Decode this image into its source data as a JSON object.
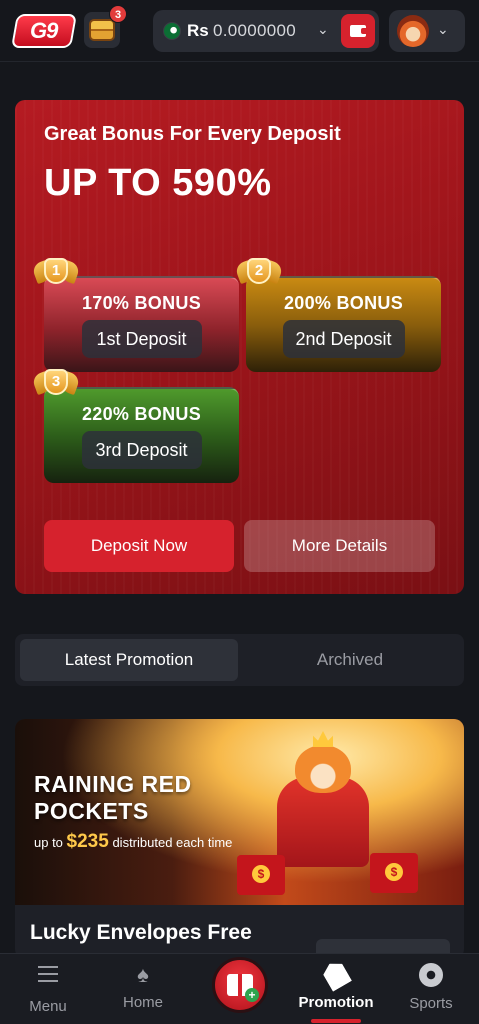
{
  "header": {
    "logo_text": "G9",
    "chest_badge": "3",
    "currency": "Rs",
    "balance": "0.0000000",
    "caret": "⌄"
  },
  "bonus": {
    "title": "Great Bonus For Every Deposit",
    "headline": "UP TO 590%",
    "tiers": [
      {
        "rank": "1",
        "label": "170% BONUS",
        "deposit": "1st Deposit"
      },
      {
        "rank": "2",
        "label": "200% BONUS",
        "deposit": "2nd Deposit"
      },
      {
        "rank": "3",
        "label": "220% BONUS",
        "deposit": "3rd Deposit"
      }
    ],
    "deposit_now": "Deposit Now",
    "more_details": "More Details"
  },
  "tabs": {
    "latest": "Latest Promotion",
    "archived": "Archived"
  },
  "promo": {
    "banner_title": "RAINING RED POCKETS",
    "sub_prefix": "up to",
    "sub_amount": "$235",
    "sub_suffix": "distributed each time",
    "name": "Lucky Envelopes Free"
  },
  "nav": {
    "menu": "Menu",
    "home": "Home",
    "promotion": "Promotion",
    "sports": "Sports",
    "gift_plus": "+"
  },
  "colors": {
    "accent": "#d6222d",
    "background": "#15171c",
    "panel": "#1e2027",
    "gold": "#ffc94a"
  },
  "icons": [
    "g9-logo",
    "treasure-chest-icon",
    "pakistan-flag-icon",
    "chevron-down-icon",
    "wallet-icon",
    "avatar",
    "medal-icon",
    "menu-icon",
    "spade-icon",
    "gift-icon",
    "tag-icon",
    "soccer-ball-icon"
  ]
}
